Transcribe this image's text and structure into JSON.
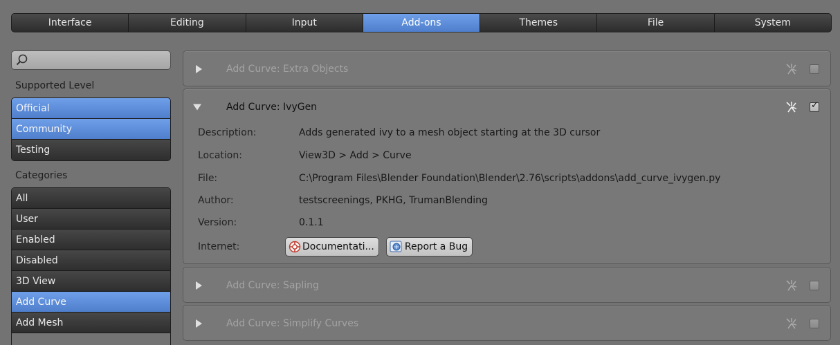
{
  "tabs": [
    {
      "label": "Interface",
      "active": false
    },
    {
      "label": "Editing",
      "active": false
    },
    {
      "label": "Input",
      "active": false
    },
    {
      "label": "Add-ons",
      "active": true
    },
    {
      "label": "Themes",
      "active": false
    },
    {
      "label": "File",
      "active": false
    },
    {
      "label": "System",
      "active": false
    }
  ],
  "search": {
    "placeholder": ""
  },
  "sidebar": {
    "supported_label": "Supported Level",
    "supported": [
      {
        "label": "Official",
        "selected": true
      },
      {
        "label": "Community",
        "selected": true
      },
      {
        "label": "Testing",
        "selected": false
      }
    ],
    "categories_label": "Categories",
    "categories": [
      {
        "label": "All",
        "selected": false
      },
      {
        "label": "User",
        "selected": false
      },
      {
        "label": "Enabled",
        "selected": false
      },
      {
        "label": "Disabled",
        "selected": false
      },
      {
        "label": "3D View",
        "selected": false
      },
      {
        "label": "Add Curve",
        "selected": true
      },
      {
        "label": "Add Mesh",
        "selected": false
      }
    ]
  },
  "addons": [
    {
      "title": "Add Curve: Extra Objects",
      "expanded": false,
      "enabled": false
    },
    {
      "title": "Add Curve: IvyGen",
      "expanded": true,
      "enabled": true,
      "details": [
        {
          "key": "Description:",
          "value": "Adds generated ivy to a mesh object starting at the 3D cursor"
        },
        {
          "key": "Location:",
          "value": "View3D > Add > Curve"
        },
        {
          "key": "File:",
          "value": "C:\\Program Files\\Blender Foundation\\Blender\\2.76\\scripts\\addons\\add_curve_ivygen.py"
        },
        {
          "key": "Author:",
          "value": "testscreenings, PKHG, TrumanBlending"
        },
        {
          "key": "Version:",
          "value": "0.1.1"
        }
      ],
      "internet_label": "Internet:",
      "doc_button": "Documentati...",
      "bug_button": "Report a Bug"
    },
    {
      "title": "Add Curve: Sapling",
      "expanded": false,
      "enabled": false
    },
    {
      "title": "Add Curve: Simplify Curves",
      "expanded": false,
      "enabled": false
    }
  ],
  "colors": {
    "accent": "#5a8ad8",
    "background": "#737373"
  }
}
